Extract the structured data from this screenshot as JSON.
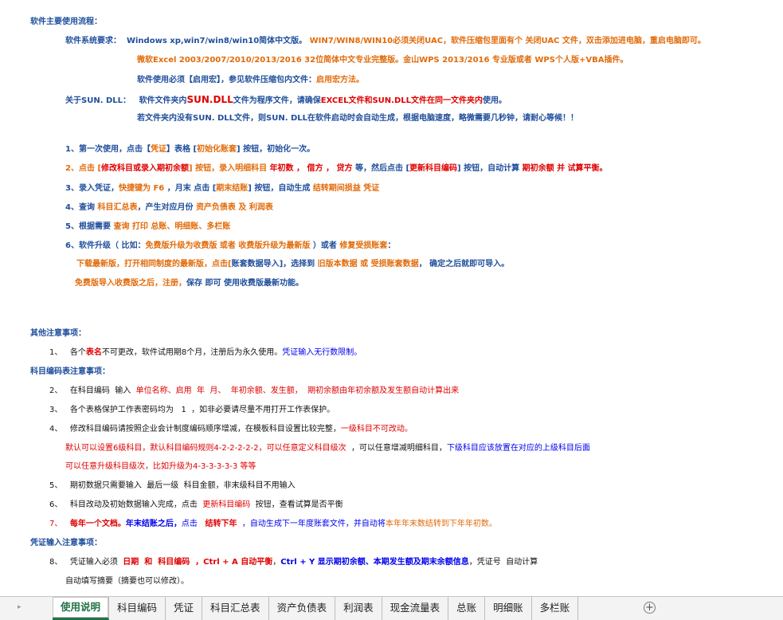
{
  "process": {
    "heading": "软件主要使用流程：",
    "req_label": "软件系统要求：",
    "req_1a": "Windows xp,win7/win8/win10简体中文版。",
    "req_1b": "WIN7/WIN8/WIN10必须关闭UAC，软件压缩包里面有个 关闭UAC 文件，双击添加进电脑，重启电脑即可。",
    "req_2a": "微软Excel 2003/2007/2010/2013/2016 32位简体中文专业完整版。",
    "req_2b": "金山WPS 2013/2016 专业版或者 WPS个人版+VBA插件。",
    "req_3a": "软件使用必须【启用宏】，参见软件压缩包内文件：",
    "req_3b": "启用宏方法。",
    "dll_label": "关于SUN. DLL：",
    "dll_1a": "软件文件夹内",
    "dll_1b": "SUN.DLL",
    "dll_1c": "文件为程序文件，请确保",
    "dll_1d": "EXCEL文件和SUN.DLL文件在同一文件夹内",
    "dll_1e": "使用。",
    "dll_2": "若文件夹内没有SUN. DLL文件，则SUN. DLL在软件启动时会自动生成，根据电脑速度，略微需要几秒钟，请耐心等候！！"
  },
  "steps": {
    "s1a": "1、第一次使用，点击【",
    "s1b": "凭证",
    "s1c": "】表格 [",
    "s1d": "初始化账套",
    "s1e": "] 按钮，初始化一次。",
    "s2a": "2、点击 [",
    "s2b": "修改科目或录入期初余额",
    "s2c": "] 按钮，录入明细科目 ",
    "s2d": "年初数 ， 借方 ， 贷方",
    "s2e": " 等，然后点击 [",
    "s2f": "更新科目编码",
    "s2g": "] 按钮，自动计算 ",
    "s2h": "期初余额 并 试算平衡。",
    "s3a": "3、录入凭证，",
    "s3b": "快捷键为 F6",
    "s3c": " ，月末 点击 [",
    "s3d": "期末结账",
    "s3e": "] 按钮，自动生成 ",
    "s3f": "结转期间损益 凭证",
    "s4a": "4、查询 ",
    "s4b": "科目汇总表",
    "s4c": "，产生对应月份 ",
    "s4d": "资产负债表 及 利润表",
    "s5a": "5、根据需要 ",
    "s5b": "查询 打印 总账、明细账、多栏账",
    "s6a": "6、软件升级（ 比如：",
    "s6b": "免费版升级为收费版 或者 收费版升级为最新版",
    "s6c": " ）或者 ",
    "s6d": "修复受损账套",
    "s6e": "：",
    "s7a": "下载最新版，打开相同制度的最新版，点击[",
    "s7b": "账套数据导入",
    "s7c": "]，选择到 ",
    "s7d": "旧版本数据 或 受损账套数据",
    "s7e": "， 确定之后就即可导入。",
    "s8a": "免费版导入收费版之后，注册，",
    "s8b": "保存 即可 使用收费版最新功能。"
  },
  "notes": {
    "other_heading": "其他注意事项：",
    "o1n": "1、",
    "o1a": "各个",
    "o1b": "表名",
    "o1c": "不可更改，软件试用期8个月，注册后为永久使用。",
    "o1d": "凭证输入无行数限制。",
    "code_heading": "科目编码表注意事项：",
    "c2n": "2、",
    "c2a": "在科目编码  输入  ",
    "c2b": "单位名称、启用  年  月、  年初余额、发生额，  期初余额由年初余额及发生额自动计算出来",
    "c3n": "3、",
    "c3a": "各个表格保护工作表密码均为   1  ，如非必要请尽量不用打开工作表保护。",
    "c4n": "4、",
    "c4a": "修改科目编码请按照企业会计制度编码顺序增减，在模板科目设置比较完整，",
    "c4b": "一级科目不可改动。",
    "c4c": "默认可以设置6级科目，默认科目编码规则4-2-2-2-2-2，可以任意定义科目级次  ",
    "c4d": "，可以任意增减明细科目，",
    "c4e": "下级科目应该放置在对应的上级科目后面",
    "c4f": "可以任意升级科目级次，比如升级为4-3-3-3-3-3  等等",
    "c5n": "5、",
    "c5a": "期初数据只需要输入  最后一级  科目金额，非末级科目不用输入",
    "c6n": "6、",
    "c6a": "科目改动及初始数据输入完成，点击  ",
    "c6b": "更新科目编码",
    "c6c": "  按钮，查看试算是否平衡",
    "c7n": "7、",
    "c7a": "每年一个文档。",
    "c7b": "年末结账之后，",
    "c7c": "点击   ",
    "c7d": "结转下年",
    "c7e": "  ，自动生成下一年度账套文件，并自动将",
    "c7f": "本年年末数结转到下年年初数。",
    "voucher_heading": "凭证输入注意事项：",
    "v8n": "8、",
    "v8a": "凭证输入必须  ",
    "v8b": "日期  和  科目编码",
    "v8c": "  ，Ctrl + A 自动平衡",
    "v8d": "，",
    "v8e": "Ctrl + Y 显示期初余额、本期发生额及期末余额信息",
    "v8f": "，凭证号  自动计算",
    "v9": "自动填写摘要（摘要也可以修改）。"
  },
  "tabs": [
    "使用说明",
    "科目编码",
    "凭证",
    "科目汇总表",
    "资产负债表",
    "利润表",
    "现金流量表",
    "总账",
    "明细账",
    "多栏账"
  ],
  "active_tab": "使用说明",
  "colors": {
    "blue": "#1f4e9c",
    "red": "#e00000",
    "orange": "#e26b0a",
    "tab_active": "#217346"
  }
}
